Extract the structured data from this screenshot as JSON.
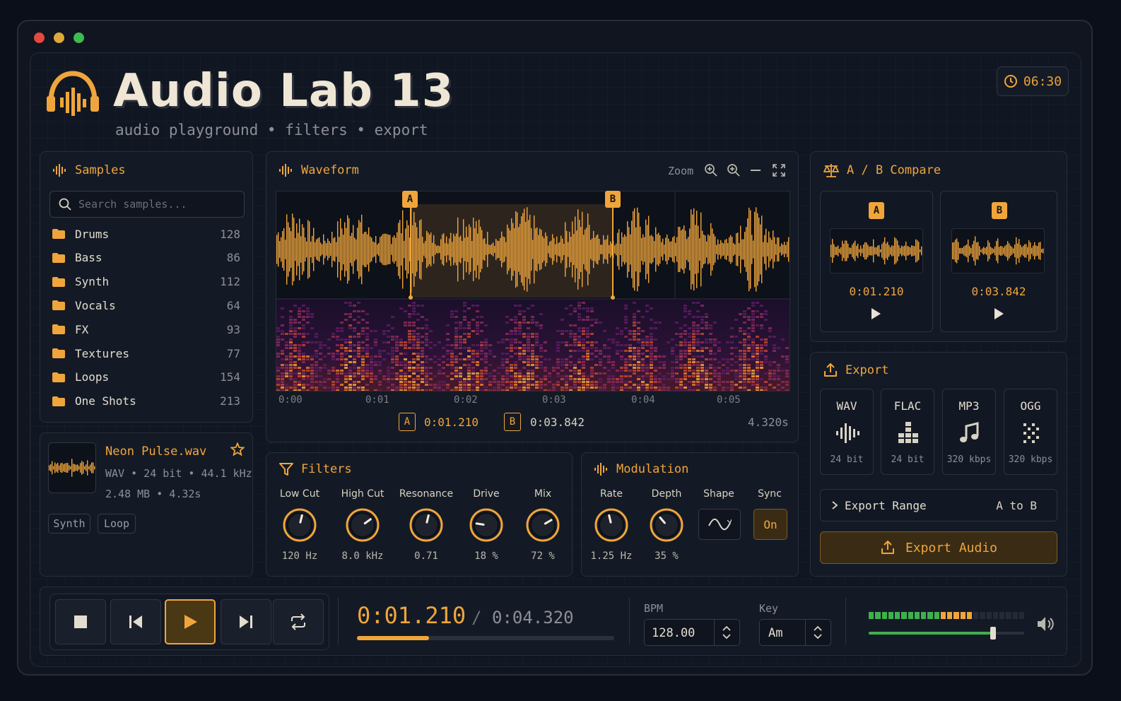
{
  "app": {
    "title": "Audio Lab 13",
    "subtitle": "audio playground • filters • export",
    "clock": "06:30",
    "accent": "#f0a53c"
  },
  "samples": {
    "title": "Samples",
    "search_placeholder": "Search samples...",
    "categories": [
      {
        "name": "Drums",
        "count": "128"
      },
      {
        "name": "Bass",
        "count": "86"
      },
      {
        "name": "Synth",
        "count": "112"
      },
      {
        "name": "Vocals",
        "count": "64"
      },
      {
        "name": "FX",
        "count": "93"
      },
      {
        "name": "Textures",
        "count": "77"
      },
      {
        "name": "Loops",
        "count": "154"
      },
      {
        "name": "One Shots",
        "count": "213"
      }
    ]
  },
  "now": {
    "file": "Neon Pulse.wav",
    "meta1": "WAV • 24 bit • 44.1 kHz",
    "meta2": "2.48 MB • 4.32s",
    "tags": [
      "Synth",
      "Loop"
    ]
  },
  "waveform": {
    "title": "Waveform",
    "zoom_label": "Zoom",
    "ticks": [
      "0:00",
      "0:01",
      "0:02",
      "0:03",
      "0:04",
      "0:05"
    ],
    "marker_a_label": "A",
    "marker_b_label": "B",
    "a_time": "0:01.210",
    "b_time": "0:03.842",
    "duration": "4.320s"
  },
  "filters": {
    "title": "Filters",
    "knobs": [
      {
        "label": "Low Cut",
        "value": "120 Hz",
        "level": 0.55
      },
      {
        "label": "High Cut",
        "value": "8.0 kHz",
        "level": 0.7
      },
      {
        "label": "Resonance",
        "value": "0.71",
        "level": 0.55
      },
      {
        "label": "Drive",
        "value": "18 %",
        "level": 0.2
      },
      {
        "label": "Mix",
        "value": "72 %",
        "level": 0.72
      }
    ]
  },
  "modulation": {
    "title": "Modulation",
    "rate_label": "Rate",
    "rate_value": "1.25 Hz",
    "rate_level": 0.45,
    "depth_label": "Depth",
    "depth_value": "35 %",
    "depth_level": 0.35,
    "shape_label": "Shape",
    "sync_label": "Sync",
    "sync_value": "On"
  },
  "compare": {
    "title": "A / B Compare",
    "a_label": "A",
    "b_label": "B",
    "a_time": "0:01.210",
    "b_time": "0:03.842"
  },
  "export": {
    "title": "Export",
    "formats": [
      {
        "name": "WAV",
        "sub": "24 bit",
        "icon": "waveform-icon"
      },
      {
        "name": "FLAC",
        "sub": "24 bit",
        "icon": "bars-icon"
      },
      {
        "name": "MP3",
        "sub": "320 kbps",
        "icon": "music-note-icon"
      },
      {
        "name": "OGG",
        "sub": "320 kbps",
        "icon": "dots-icon"
      }
    ],
    "range_label": "Export Range",
    "range_value": "A to B",
    "button_label": "Export Audio"
  },
  "transport": {
    "current": "0:01.210",
    "separator": "/",
    "total": "0:04.320",
    "progress": 0.28,
    "bpm_label": "BPM",
    "bpm": "128.00",
    "key_label": "Key",
    "key": "Am",
    "volume_level": 0.8,
    "meter_level": 0.67
  }
}
